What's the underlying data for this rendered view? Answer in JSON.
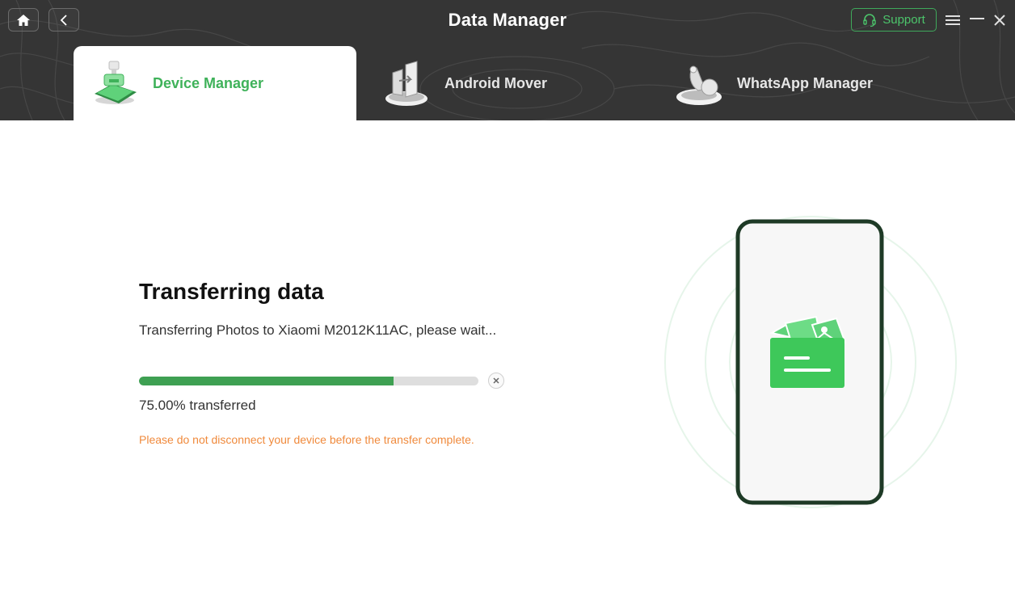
{
  "app": {
    "title": "Data Manager",
    "support_label": "Support"
  },
  "tabs": [
    {
      "label": "Device Manager",
      "active": true,
      "icon": "device-manager-icon"
    },
    {
      "label": "Android Mover",
      "active": false,
      "icon": "android-mover-icon"
    },
    {
      "label": "WhatsApp Manager",
      "active": false,
      "icon": "whatsapp-manager-icon"
    }
  ],
  "transfer": {
    "title": "Transferring data",
    "subtitle": "Transferring Photos to Xiaomi M2012K11AC, please wait...",
    "progress": 0.75,
    "progress_label": "75.00% transferred",
    "warning": "Please do not disconnect your device before the transfer complete."
  },
  "colors": {
    "accent": "#3fb25a",
    "progress": "#3ea052",
    "warning": "#f08a3c",
    "header": "#353535"
  }
}
